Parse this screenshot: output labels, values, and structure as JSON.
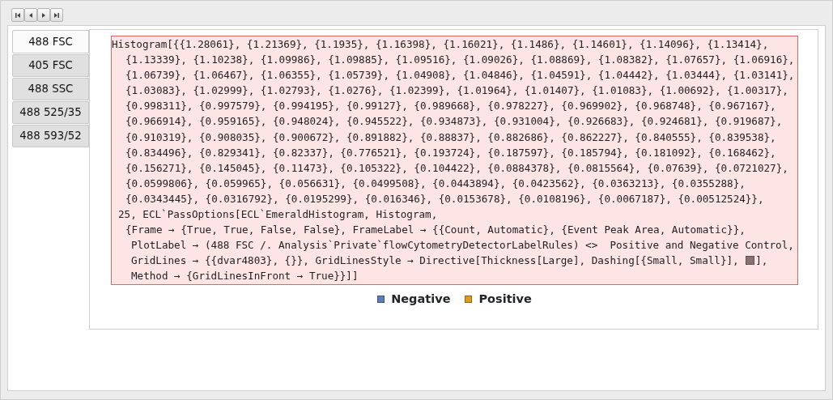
{
  "nav_buttons": [
    {
      "kind": "first"
    },
    {
      "kind": "prev"
    },
    {
      "kind": "next"
    },
    {
      "kind": "last"
    }
  ],
  "tabs": [
    {
      "label": "488 FSC",
      "selected": true
    },
    {
      "label": "405 FSC",
      "selected": false
    },
    {
      "label": "488 SSC",
      "selected": false
    },
    {
      "label": "488 525/35",
      "selected": false
    },
    {
      "label": "488 593/52",
      "selected": false
    }
  ],
  "message": {
    "lines": [
      {
        "kind": "head",
        "text": "Histogram[{{1.28061}, {1.21369}, {1.1935}, {1.16398}, {1.16021}, {1.1486}, {1.14601}, {1.14096}, {1.13414},"
      },
      {
        "kind": "data",
        "text": "{1.13339}, {1.10238}, {1.09986}, {1.09885}, {1.09516}, {1.09026}, {1.08869}, {1.08382}, {1.07657}, {1.06916},"
      },
      {
        "kind": "data",
        "text": "{1.06739}, {1.06467}, {1.06355}, {1.05739}, {1.04908}, {1.04846}, {1.04591}, {1.04442}, {1.03444}, {1.03141},"
      },
      {
        "kind": "data",
        "text": "{1.03083}, {1.02999}, {1.02793}, {1.0276}, {1.02399}, {1.01964}, {1.01407}, {1.01083}, {1.00692}, {1.00317},"
      },
      {
        "kind": "data",
        "text": "{0.998311}, {0.997579}, {0.994195}, {0.99127}, {0.989668}, {0.978227}, {0.969902}, {0.968748}, {0.967167},"
      },
      {
        "kind": "data",
        "text": "{0.966914}, {0.959165}, {0.948024}, {0.945522}, {0.934873}, {0.931004}, {0.926683}, {0.924681}, {0.919687},"
      },
      {
        "kind": "data",
        "text": "{0.910319}, {0.908035}, {0.900672}, {0.891882}, {0.88837}, {0.882686}, {0.862227}, {0.840555}, {0.839538},"
      },
      {
        "kind": "data",
        "text": "{0.834496}, {0.829341}, {0.82337}, {0.776521}, {0.193724}, {0.187597}, {0.185794}, {0.181092}, {0.168462},"
      },
      {
        "kind": "data",
        "text": "{0.156271}, {0.145045}, {0.11473}, {0.105322}, {0.104422}, {0.0884378}, {0.0815564}, {0.07639}, {0.0721027},"
      },
      {
        "kind": "data",
        "text": "{0.0599806}, {0.059965}, {0.056631}, {0.0499508}, {0.0443894}, {0.0423562}, {0.0363213}, {0.0355288},"
      },
      {
        "kind": "data",
        "text": "{0.0343445}, {0.0316792}, {0.0195299}, {0.016346}, {0.0153678}, {0.0108196}, {0.0067187}, {0.00512524}},"
      },
      {
        "kind": "arg",
        "text": "25, ECL`PassOptions[ECL`EmeraldHistogram, Histogram,"
      },
      {
        "kind": "data",
        "text": "{Frame → {True, True, False, False}, FrameLabel → {{Count, Automatic}, {Event Peak Area, Automatic}},"
      },
      {
        "kind": "option",
        "text": "PlotLabel → (488 FSC /. Analysis`Private`flowCytometryDetectorLabelRules) <>  Positive and Negative Control,"
      },
      {
        "kind": "option",
        "text": "GridLines → {{dvar4803}, {}}, GridLinesStyle → Directive[Thickness[Large], Dashing[{Small, Small}], ",
        "swatch": true,
        "after": "],"
      },
      {
        "kind": "option",
        "text": "Method → {GridLinesInFront → True}}]]"
      }
    ]
  },
  "legend": [
    {
      "label": "Negative",
      "color": "#5b7fb4"
    },
    {
      "label": "Positive",
      "color": "#e09a22"
    }
  ]
}
